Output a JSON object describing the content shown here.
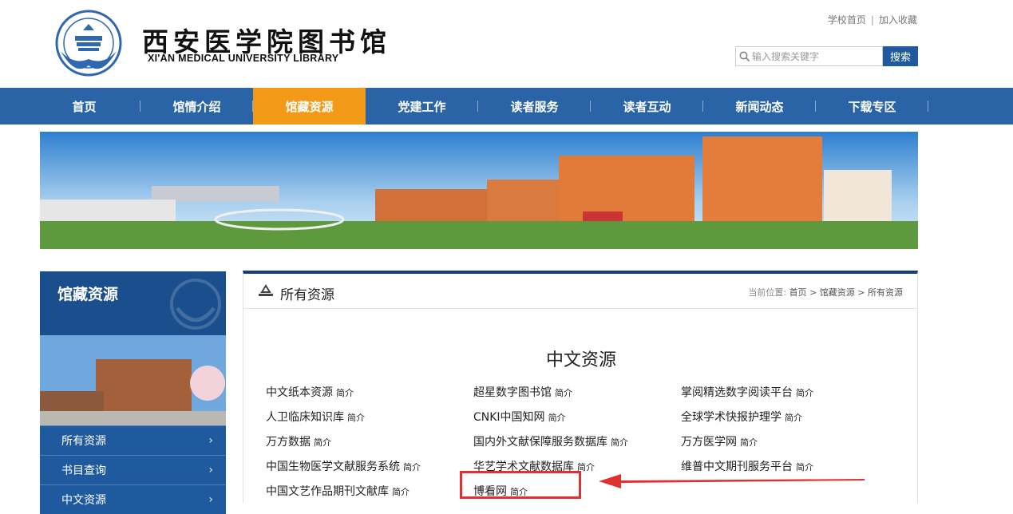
{
  "header": {
    "logo_cn": "西安医学院图书馆",
    "logo_en": "XI'AN MEDICAL UNIVERSITY LIBRARY",
    "top_links": [
      "学校首页",
      "加入收藏"
    ],
    "search_placeholder": "输入搜索关键字",
    "search_button": "搜索"
  },
  "nav": {
    "items": [
      "首页",
      "馆情介绍",
      "馆藏资源",
      "党建工作",
      "读者服务",
      "读者互动",
      "新闻动态",
      "下载专区"
    ],
    "active_index": 2
  },
  "sidebar": {
    "title": "馆藏资源",
    "items": [
      "所有资源",
      "书目查询",
      "中文资源"
    ]
  },
  "content": {
    "title": "所有资源",
    "breadcrumb_label": "当前位置:",
    "breadcrumb": [
      "首页",
      "馆藏资源",
      "所有资源"
    ],
    "section_title": "中文资源",
    "intro_label": "简介",
    "resources": [
      [
        "中文纸本资源",
        "超星数字图书馆",
        "掌阅精选数字阅读平台"
      ],
      [
        "人卫临床知识库",
        "CNKI中国知网",
        "全球学术快报护理学"
      ],
      [
        "万方数据",
        "国内外文献保障服务数据库",
        "万方医学网"
      ],
      [
        "中国生物医学文献服务系统",
        "华艺学术文献数据库",
        "维普中文期刊服务平台"
      ],
      [
        "中国文艺作品期刊文献库",
        "博看网",
        ""
      ]
    ]
  },
  "colors": {
    "nav_bg": "#2a64a6",
    "nav_active": "#f29a17",
    "sidebar_bg": "#1f5a9e",
    "annotation_red": "#e03030"
  }
}
